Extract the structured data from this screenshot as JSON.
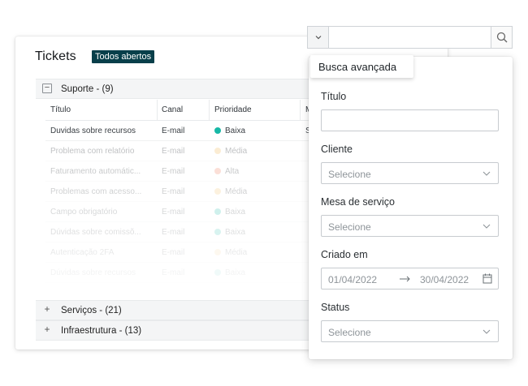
{
  "tickets": {
    "title": "Tickets",
    "badge": "Todos abertos",
    "groups": [
      {
        "label": "Suporte - (9)",
        "expanded": true
      },
      {
        "label": "Serviços - (21)",
        "expanded": false
      },
      {
        "label": "Infraestrutura - (13)",
        "expanded": false
      }
    ],
    "columns": [
      "Título",
      "Canal",
      "Prioridade",
      "M"
    ],
    "rows": [
      {
        "title": "Duvidas sobre recursos",
        "channel": "E-mail",
        "priority": "Baixa",
        "color": "#17b8a6",
        "extra": "S",
        "opacity": 1
      },
      {
        "title": "Problema com relatório",
        "channel": "E-mail",
        "priority": "Média",
        "color": "#f5c77a",
        "extra": "",
        "opacity": 0.32
      },
      {
        "title": "Faturamento automátic...",
        "channel": "E-mail",
        "priority": "Alta",
        "color": "#f28e74",
        "extra": "",
        "opacity": 0.28
      },
      {
        "title": "Problemas com acesso...",
        "channel": "E-mail",
        "priority": "Média",
        "color": "#f5c77a",
        "extra": "",
        "opacity": 0.24
      },
      {
        "title": "Campo obrigatório",
        "channel": "E-mail",
        "priority": "Baixa",
        "color": "#17b8a6",
        "extra": "",
        "opacity": 0.2
      },
      {
        "title": "Dúvidas sobre comissõ...",
        "channel": "E-mail",
        "priority": "Baixa",
        "color": "#17b8a6",
        "extra": "",
        "opacity": 0.16
      },
      {
        "title": "Autenticação 2FA",
        "channel": "E-mail",
        "priority": "Média",
        "color": "#f5c77a",
        "extra": "",
        "opacity": 0.11
      },
      {
        "title": "Dúvidas sobre recursos",
        "channel": "E-mail",
        "priority": "Baixa",
        "color": "#17b8a6",
        "extra": "",
        "opacity": 0.06
      }
    ]
  },
  "search": {
    "value": "",
    "placeholder": ""
  },
  "advanced": {
    "title": "Busca avançada",
    "fields": {
      "title_label": "Título",
      "client_label": "Cliente",
      "client_value": "Selecione",
      "desk_label": "Mesa de serviço",
      "desk_value": "Selecione",
      "created_label": "Criado em",
      "date_from": "01/04/2022",
      "date_to": "30/04/2022",
      "status_label": "Status",
      "status_value": "Selecione"
    }
  },
  "colors": {
    "badge_bg": "#083f4a",
    "text_muted": "#8e9499"
  }
}
